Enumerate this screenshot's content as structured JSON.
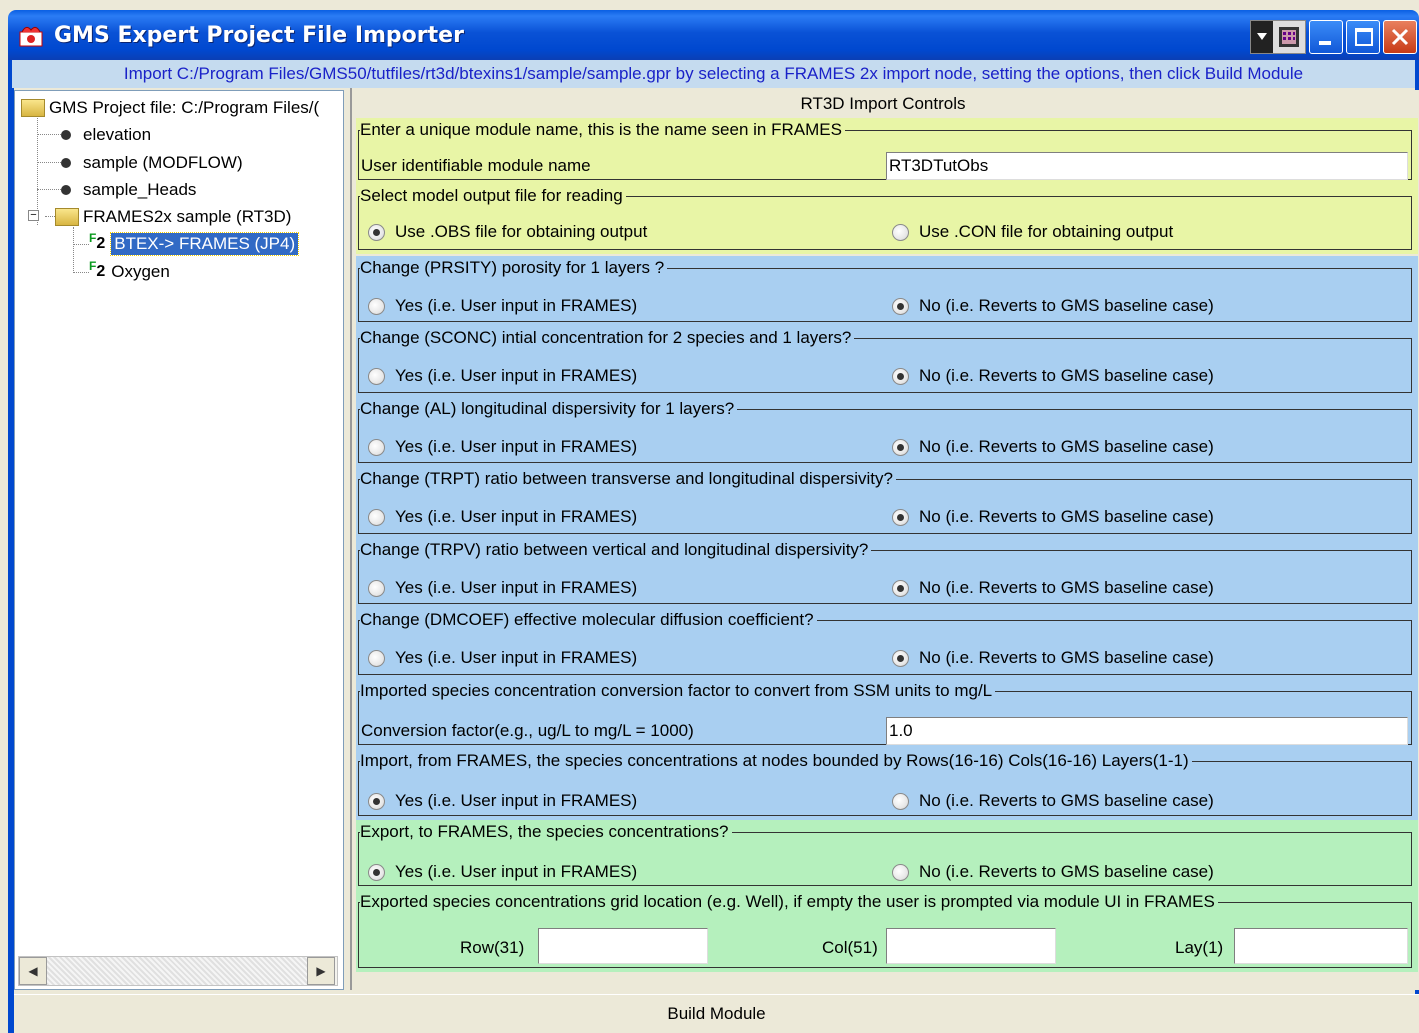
{
  "window": {
    "title": "GMS Expert Project File Importer",
    "info": "Import C:/Program Files/GMS50/tutfiles/rt3d/btexins1/sample/sample.gpr by selecting a FRAMES 2x import node, setting the options, then click Build Module"
  },
  "tree": {
    "root": "GMS Project file: C:/Program Files/(",
    "items": [
      {
        "label": "elevation",
        "icon": "bullet-icon"
      },
      {
        "label": "sample (MODFLOW)",
        "icon": "bullet-icon"
      },
      {
        "label": "sample_Heads",
        "icon": "bullet-icon"
      },
      {
        "label": "FRAMES2x sample (RT3D)",
        "icon": "folder-icon"
      },
      {
        "label": "BTEX-> FRAMES (JP4)",
        "icon": "f2-icon",
        "selected": true
      },
      {
        "label": "Oxygen",
        "icon": "f2-icon"
      }
    ],
    "f2_text": "2",
    "f2_sup": "F",
    "expander": "−"
  },
  "controls": {
    "header": "RT3D Import Controls",
    "module": {
      "legend": "Enter a unique module name, this is the name seen in FRAMES",
      "label": "User identifiable module name",
      "value": "RT3DTutObs"
    },
    "output": {
      "legend": "Select model output file for reading",
      "opt1": "Use .OBS file for obtaining output",
      "opt2": "Use .CON file for obtaining output",
      "selected": 1
    },
    "yes_label": "Yes (i.e. User input in FRAMES)",
    "no_label": "No (i.e. Reverts to GMS baseline case)",
    "changes": [
      {
        "legend": "Change (PRSITY) porosity for 1 layers ?",
        "selected": "no"
      },
      {
        "legend": "Change (SCONC) intial concentration for 2 species and 1 layers?",
        "selected": "no"
      },
      {
        "legend": "Change (AL) longitudinal dispersivity for 1 layers?",
        "selected": "no"
      },
      {
        "legend": "Change (TRPT) ratio between transverse and longitudinal dispersivity?",
        "selected": "no"
      },
      {
        "legend": "Change (TRPV) ratio between vertical and longitudinal dispersivity?",
        "selected": "no"
      },
      {
        "legend": "Change (DMCOEF) effective molecular diffusion coefficient?",
        "selected": "no"
      }
    ],
    "conversion": {
      "legend": "Imported species concentration conversion factor to convert from SSM units to mg/L",
      "label": "Conversion factor(e.g., ug/L to mg/L = 1000)",
      "value": "1.0"
    },
    "import_conc": {
      "legend": "Import, from FRAMES, the species concentrations at nodes bounded by Rows(16-16) Cols(16-16) Layers(1-1)",
      "selected": "yes"
    },
    "export_conc": {
      "legend": "Export, to FRAMES, the species concentrations?",
      "selected": "yes"
    },
    "grid": {
      "legend": "Exported species concentrations grid location (e.g. Well), if empty the user is prompted via module UI in FRAMES",
      "row_label": "Row(31)",
      "col_label": "Col(51)",
      "lay_label": "Lay(1)",
      "row_value": "",
      "col_value": "",
      "lay_value": ""
    }
  },
  "build_button": "Build Module",
  "colors": {
    "yellow": "#e8f5a6",
    "blue": "#a9cff1",
    "green": "#b5f0bd",
    "titlebar": "#0048cf"
  }
}
